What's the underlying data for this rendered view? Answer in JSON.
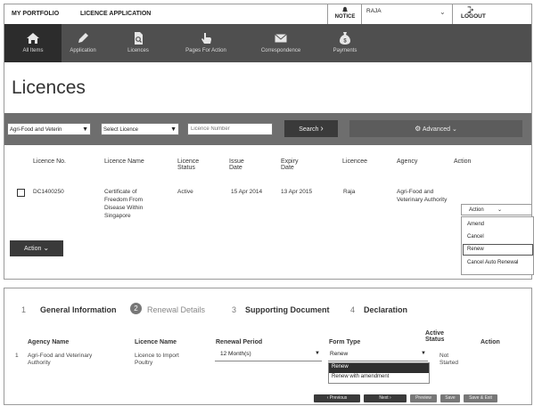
{
  "topbar": {
    "my_portfolio": "MY PORTFOLIO",
    "licence_application": "LICENCE APPLICATION",
    "notice": "NOTICE",
    "user": "RAJA",
    "logout": "LOGOUT"
  },
  "nav": {
    "items": [
      {
        "label": "All Items"
      },
      {
        "label": "Application"
      },
      {
        "label": "Licences"
      },
      {
        "label": "Pages For Action"
      },
      {
        "label": "Correspondence"
      },
      {
        "label": "Payments"
      }
    ]
  },
  "page": {
    "title": "Licences"
  },
  "filters": {
    "agency": "Agri-Food and Veterin",
    "licence": "Select Licence",
    "licence_number_placeholder": "Licence Number",
    "search_label": "Search",
    "advanced_label": "Advanced"
  },
  "table": {
    "headers": [
      "Licence No.",
      "Licence Name",
      "Licence Status",
      "Issue Date",
      "Expiry Date",
      "Licencee",
      "Agency",
      "Action"
    ],
    "rows": [
      {
        "licence_no": "DC1400250",
        "licence_name": "Certificate of Freedom From Disease Within Singapore",
        "status": "Active",
        "issue_date": "15 Apr 2014",
        "expiry_date": "13 Apr 2015",
        "licencee": "Raja",
        "agency": "Agri-Food and Veterinary Authority"
      }
    ],
    "action_select": "Action",
    "action_options": [
      "Amend",
      "Cancel",
      "Renew",
      "Cancel Auto Renewal"
    ]
  },
  "bulk_action": {
    "label": "Action"
  },
  "wizard": {
    "steps": [
      {
        "num": "1",
        "label": "General Information"
      },
      {
        "num": "2",
        "label": "Renewal Details"
      },
      {
        "num": "3",
        "label": "Supporting Document"
      },
      {
        "num": "4",
        "label": "Declaration"
      }
    ],
    "headers": {
      "agency": "Agency Name",
      "licence": "Licence Name",
      "period": "Renewal Period",
      "form_type": "Form Type",
      "active_status": "Active Status",
      "action": "Action"
    },
    "row": {
      "num": "1",
      "agency": "Agri-Food and Veterinary Authority",
      "licence": "Licence to Import Poultry",
      "period": "12 Month(s)",
      "form_type": "Renew",
      "active_status": "Not Started"
    },
    "form_type_options": [
      "Renew",
      "Renew with amendment"
    ],
    "buttons": {
      "previous": "Previous",
      "next": "Next",
      "preview": "Preview",
      "save": "Save",
      "save_exit": "Save & Exit"
    }
  }
}
